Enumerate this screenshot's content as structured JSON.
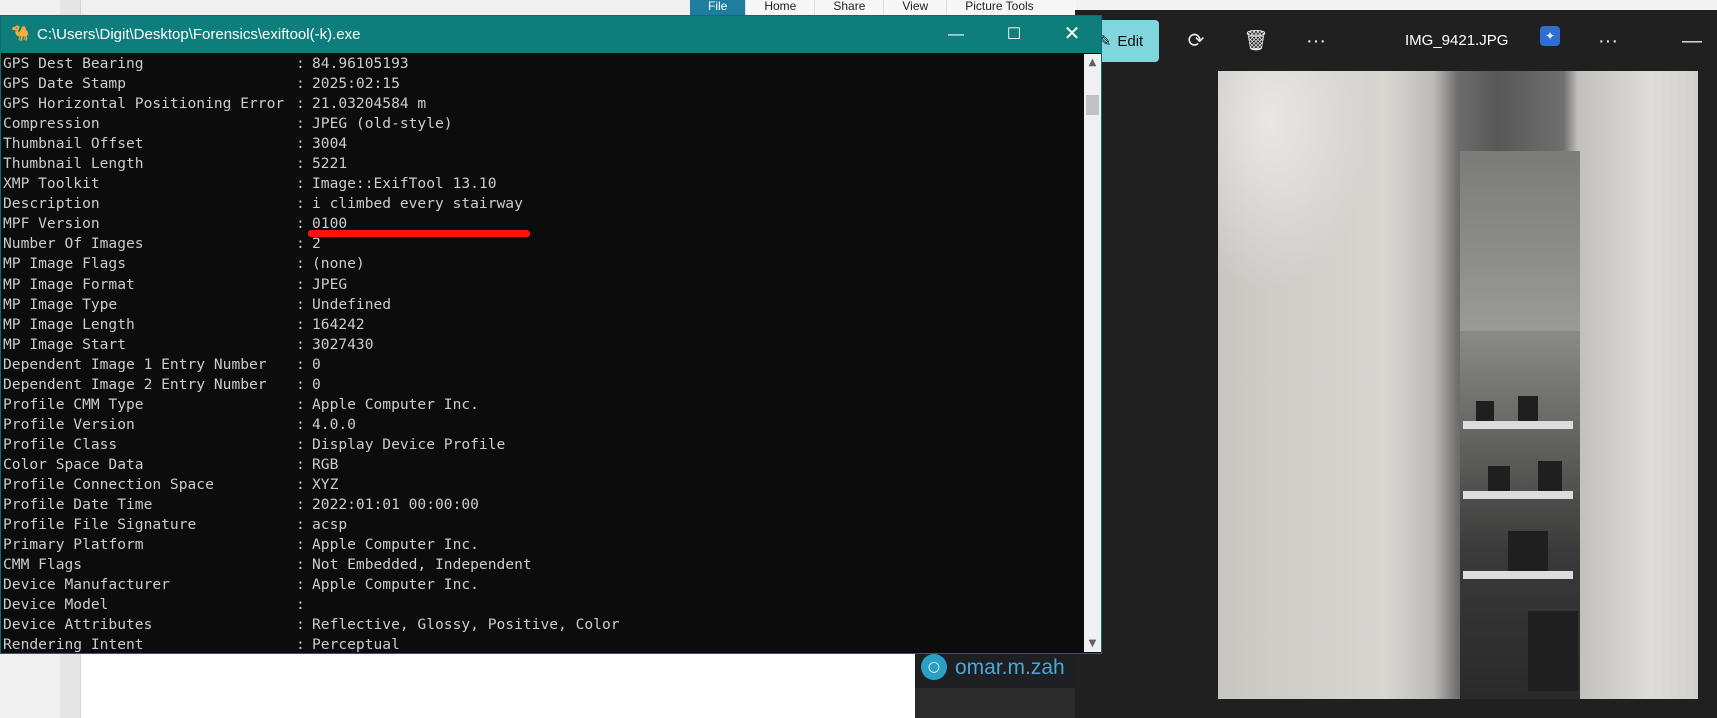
{
  "ribbon": {
    "tabs": [
      {
        "label": "File",
        "active": true
      },
      {
        "label": "Home",
        "active": false
      },
      {
        "label": "Share",
        "active": false
      },
      {
        "label": "View",
        "active": false
      },
      {
        "label": "Picture Tools",
        "active": false
      }
    ]
  },
  "terminal": {
    "title": "C:\\Users\\Digit\\Desktop\\Forensics\\exiftool(-k).exe",
    "rows": [
      {
        "label": "GPS Dest Bearing",
        "value": "84.96105193"
      },
      {
        "label": "GPS Date Stamp",
        "value": "2025:02:15"
      },
      {
        "label": "GPS Horizontal Positioning Error",
        "value": "21.03204584 m"
      },
      {
        "label": "Compression",
        "value": "JPEG (old-style)"
      },
      {
        "label": "Thumbnail Offset",
        "value": "3004"
      },
      {
        "label": "Thumbnail Length",
        "value": "5221"
      },
      {
        "label": "XMP Toolkit",
        "value": "Image::ExifTool 13.10"
      },
      {
        "label": "Description",
        "value": "i climbed every stairway"
      },
      {
        "label": "MPF Version",
        "value": "0100"
      },
      {
        "label": "Number Of Images",
        "value": "2"
      },
      {
        "label": "MP Image Flags",
        "value": "(none)"
      },
      {
        "label": "MP Image Format",
        "value": "JPEG"
      },
      {
        "label": "MP Image Type",
        "value": "Undefined"
      },
      {
        "label": "MP Image Length",
        "value": "164242"
      },
      {
        "label": "MP Image Start",
        "value": "3027430"
      },
      {
        "label": "Dependent Image 1 Entry Number",
        "value": "0"
      },
      {
        "label": "Dependent Image 2 Entry Number",
        "value": "0"
      },
      {
        "label": "Profile CMM Type",
        "value": "Apple Computer Inc."
      },
      {
        "label": "Profile Version",
        "value": "4.0.0"
      },
      {
        "label": "Profile Class",
        "value": "Display Device Profile"
      },
      {
        "label": "Color Space Data",
        "value": "RGB"
      },
      {
        "label": "Profile Connection Space",
        "value": "XYZ"
      },
      {
        "label": "Profile Date Time",
        "value": "2022:01:01 00:00:00"
      },
      {
        "label": "Profile File Signature",
        "value": "acsp"
      },
      {
        "label": "Primary Platform",
        "value": "Apple Computer Inc."
      },
      {
        "label": "CMM Flags",
        "value": "Not Embedded, Independent"
      },
      {
        "label": "Device Manufacturer",
        "value": "Apple Computer Inc."
      },
      {
        "label": "Device Model",
        "value": ""
      },
      {
        "label": "Device Attributes",
        "value": "Reflective, Glossy, Positive, Color"
      },
      {
        "label": "Rendering Intent",
        "value": "Perceptual"
      }
    ],
    "separator": ":",
    "highlight_color": "#ff1010"
  },
  "photos": {
    "edit_label": "Edit",
    "filename": "IMG_9421.JPG"
  },
  "teams": {
    "name": "omar.m.zah"
  },
  "colors": {
    "titlebar": "#0e7e7c",
    "terminal_bg": "#0c0c0c",
    "terminal_fg": "#cccccc",
    "edit_accent": "#7fd6dc"
  }
}
